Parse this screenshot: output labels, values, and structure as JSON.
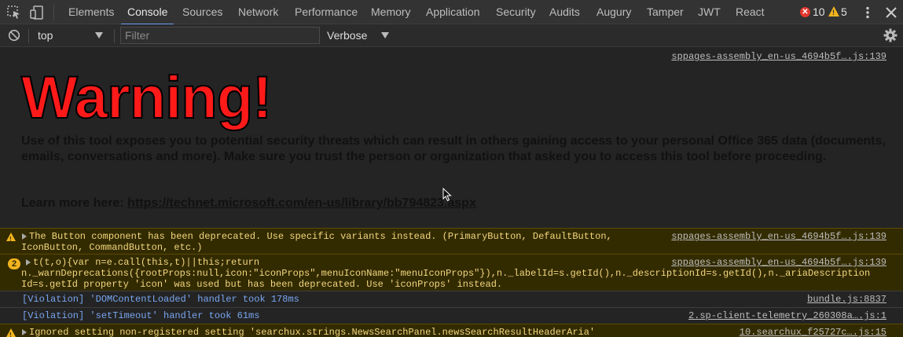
{
  "tabs": [
    "Elements",
    "Console",
    "Sources",
    "Network",
    "Performance",
    "Memory",
    "Application",
    "Security",
    "Audits",
    "Augury",
    "Tamper",
    "JWT",
    "React"
  ],
  "active_tab": "Console",
  "status": {
    "errors": "10",
    "warnings": "5"
  },
  "filterbar": {
    "context": "top",
    "filter_placeholder": "Filter",
    "levels": "Verbose"
  },
  "banner": {
    "source": "sppages-assembly_en-us_4694b5f….js:139",
    "title": "Warning!",
    "body": "Use of this tool exposes you to potential security threats which can result in others gaining access to your personal Office 365 data (documents, emails, conversations and more). Make sure you trust the person or organization that asked you to access this tool before proceeding.",
    "learn_label": "Learn more here:",
    "learn_link": "https://technet.microsoft.com/en-us/library/bb794823.aspx"
  },
  "messages": [
    {
      "level": "warning",
      "lines": [
        "The Button component has been deprecated. Use specific variants instead. (PrimaryButton, DefaultButton,",
        "IconButton, CommandButton, etc.)"
      ],
      "source": "sppages-assembly_en-us_4694b5f….js:139"
    },
    {
      "level": "warning",
      "repeat": "2",
      "lines": [
        "t(t,o){var n=e.call(this,t)||this;return",
        "n._warnDeprecations({rootProps:null,icon:\"iconProps\",menuIconName:\"menuIconProps\"}),n._labelId=s.getId(),n._descriptionId=s.getId(),n._ariaDescription",
        "Id=s.getId property 'icon' was used but has been deprecated. Use 'iconProps' instead."
      ],
      "source": "sppages-assembly_en-us_4694b5f….js:139"
    },
    {
      "level": "verbose",
      "lines": [
        "[Violation] 'DOMContentLoaded' handler took 178ms"
      ],
      "source": "bundle.js:8837"
    },
    {
      "level": "verbose",
      "lines": [
        "[Violation] 'setTimeout' handler took 61ms"
      ],
      "source": "2.sp-client-telemetry_260308a….js:1"
    },
    {
      "level": "warning",
      "lines": [
        "Ignored setting non-registered setting 'searchux.strings.NewsSearchPanel.newsSearchResultHeaderAria'"
      ],
      "source": "10.searchux_f25727c….js:15"
    }
  ]
}
